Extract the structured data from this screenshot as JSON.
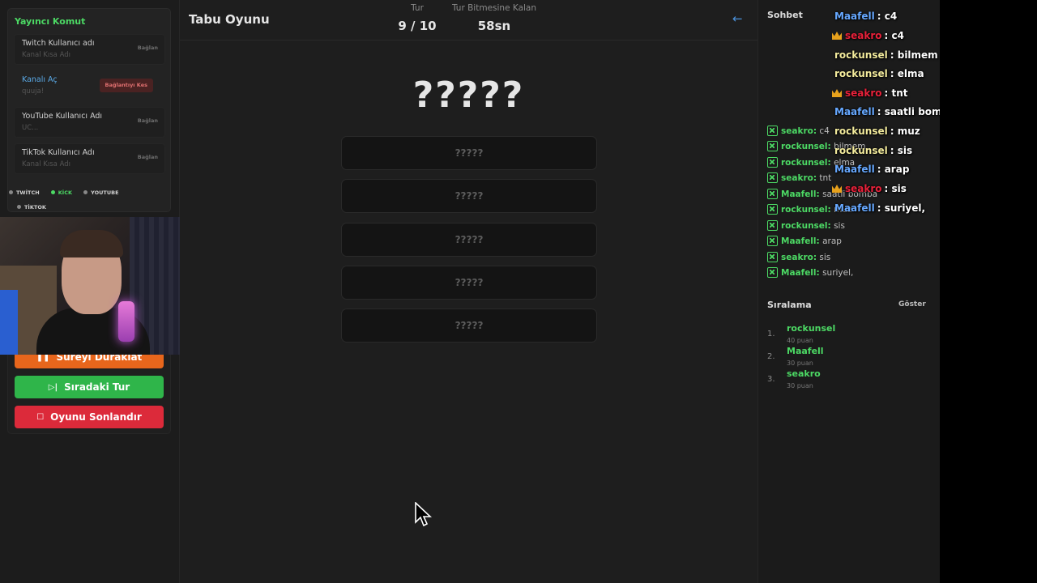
{
  "settings": {
    "title": "Yayıncı Komut",
    "accounts": [
      {
        "label": "Twitch Kullanıcı adı",
        "sub": "Kanal Kısa Adı",
        "button": "Bağlan"
      },
      {
        "label": "Kanalı Aç",
        "sub": "quuja!",
        "button": "Bağlantıyı Kes"
      },
      {
        "label": "YouTube Kullanıcı Adı",
        "sub": "UC...",
        "button": "Bağlan"
      },
      {
        "label": "TikTok Kullanıcı Adı",
        "sub": "Kanal Kısa Adı",
        "button": "Bağlan"
      }
    ],
    "platforms": [
      {
        "label": "TWİTCH",
        "active": false
      },
      {
        "label": "KİCK",
        "active": true
      },
      {
        "label": "YOUTUBE",
        "active": false
      },
      {
        "label": "TİKTOK",
        "active": false
      }
    ]
  },
  "controls": {
    "pause": "Süreyi Duraklat",
    "next": "Sıradaki Tur",
    "end": "Oyunu Sonlandır"
  },
  "header": {
    "title": "Tabu Oyunu",
    "round_label": "Tur",
    "round_value": "9 / 10",
    "time_label": "Tur Bitmesine Kalan",
    "time_value": "58sn"
  },
  "card": {
    "word": "?????",
    "taboo": [
      "?????",
      "?????",
      "?????",
      "?????",
      "?????"
    ]
  },
  "chat": {
    "title": "Sohbet",
    "messages": [
      {
        "user": "seakro:",
        "text": "c4"
      },
      {
        "user": "rockunsel:",
        "text": "bilmem"
      },
      {
        "user": "rockunsel:",
        "text": "elma"
      },
      {
        "user": "seakro:",
        "text": "tnt"
      },
      {
        "user": "Maafell:",
        "text": "saatli bomba"
      },
      {
        "user": "rockunsel:",
        "text": "muz"
      },
      {
        "user": "rockunsel:",
        "text": "sis"
      },
      {
        "user": "Maafell:",
        "text": "arap"
      },
      {
        "user": "seakro:",
        "text": "sis"
      },
      {
        "user": "Maafell:",
        "text": "suriyel,"
      }
    ]
  },
  "ranking": {
    "title": "Sıralama",
    "show": "Göster",
    "entries": [
      {
        "rank": "1.",
        "name": "rockunsel",
        "points": "40 puan"
      },
      {
        "rank": "2.",
        "name": "Maafell",
        "points": "30 puan"
      },
      {
        "rank": "3.",
        "name": "seakro",
        "points": "30 puan"
      }
    ]
  },
  "overlay_chat": [
    {
      "name": "Maafell",
      "msg": ": c4",
      "color": "#66a8ff",
      "crown": false
    },
    {
      "name": "seakro",
      "msg": ": c4",
      "color": "#e8213a",
      "crown": true
    },
    {
      "name": "rockunsel",
      "msg": ": bilmem",
      "color": "#f2ea9c",
      "crown": false
    },
    {
      "name": "rockunsel",
      "msg": ": elma",
      "color": "#f2ea9c",
      "crown": false
    },
    {
      "name": "seakro",
      "msg": ": tnt",
      "color": "#e8213a",
      "crown": true
    },
    {
      "name": "Maafell",
      "msg": ": saatli bomba",
      "color": "#66a8ff",
      "crown": false
    },
    {
      "name": "rockunsel",
      "msg": ": muz",
      "color": "#f2ea9c",
      "crown": false
    },
    {
      "name": "rockunsel",
      "msg": ": sis",
      "color": "#f2ea9c",
      "crown": false
    },
    {
      "name": "Maafell",
      "msg": ": arap",
      "color": "#66a8ff",
      "crown": false
    },
    {
      "name": "seakro",
      "msg": ": sis",
      "color": "#e8213a",
      "crown": true
    },
    {
      "name": "Maafell",
      "msg": ": suriyel,",
      "color": "#66a8ff",
      "crown": false
    }
  ]
}
